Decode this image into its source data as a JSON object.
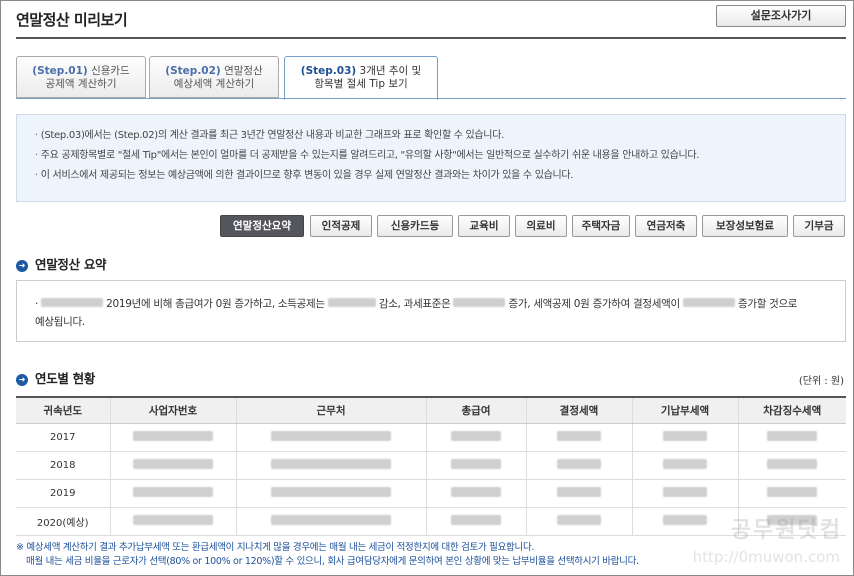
{
  "header": {
    "title": "연말정산 미리보기",
    "survey_button": "설문조사가기"
  },
  "tabs": [
    {
      "step": "(Step.01)",
      "line1": "신용카드",
      "line2": "공제액 계산하기",
      "active": false
    },
    {
      "step": "(Step.02)",
      "line1": "연말정산",
      "line2": "예상세액 계산하기",
      "active": false
    },
    {
      "step": "(Step.03)",
      "line1": "3개년 추이 및",
      "line2": "항목별 절세 Tip 보기",
      "active": true
    }
  ],
  "info": [
    "(Step.03)에서는 (Step.02)의 계산 결과를 최근 3년간 연말정산 내용과 비교한 그래프와 표로 확인할 수 있습니다.",
    "주요 공제항목별로 \"절세 Tip\"에서는 본인이 얼마를 더 공제받을 수 있는지를 알려드리고, \"유의할 사항\"에서는 일반적으로 실수하기 쉬운 내용을 안내하고 있습니다.",
    "이 서비스에서 제공되는 정보는 예상금액에 의한 결과이므로 향후 변동이 있을 경우 실제 연말정산 결과와는 차이가 있을 수 있습니다."
  ],
  "filters": [
    "연말정산요약",
    "인적공제",
    "신용카드등",
    "교육비",
    "의료비",
    "주택자금",
    "연금저축",
    "보장성보험료",
    "기부금"
  ],
  "active_filter": "연말정산요약",
  "summary": {
    "title": "연말정산 요약",
    "t1": "2019년에 비해 총급여가 0원 증가하고, 소득공제는",
    "t2": "감소, 과세표준은",
    "t3": "증가, 세액공제 0원 증가하여 결정세액이",
    "t4": "증가할 것으로",
    "t5": "예상됩니다."
  },
  "yearly": {
    "title": "연도별 현황",
    "unit": "(단위 : 원)",
    "columns": [
      "귀속년도",
      "사업자번호",
      "근무처",
      "총급여",
      "결정세액",
      "기납부세액",
      "차감징수세액"
    ],
    "rows": [
      "2017",
      "2018",
      "2019",
      "2020(예상)"
    ]
  },
  "notes": {
    "line1": "※ 예상세액 계산하기 결과 추가납부세액 또는 환급세액이 지나치게 많을 경우에는 매월 내는 세금이 적정한지에 대한 검토가 필요합니다.",
    "line2": "매월 내는 세금 비율을 근로자가 선택(80% or 100% or 120%)할 수 있으니, 회사 급여담당자에게 문의하여 본인 상황에 맞는 납부비율을 선택하시기 바랍니다."
  },
  "watermark": {
    "text": "공무원닷컴",
    "url": "http://0muwon.com"
  },
  "colors": {
    "accent": "#1d5aa6",
    "active_filter_bg": "#55565c",
    "info_bg": "#eef4fb",
    "note_text": "#1a4f9a"
  }
}
